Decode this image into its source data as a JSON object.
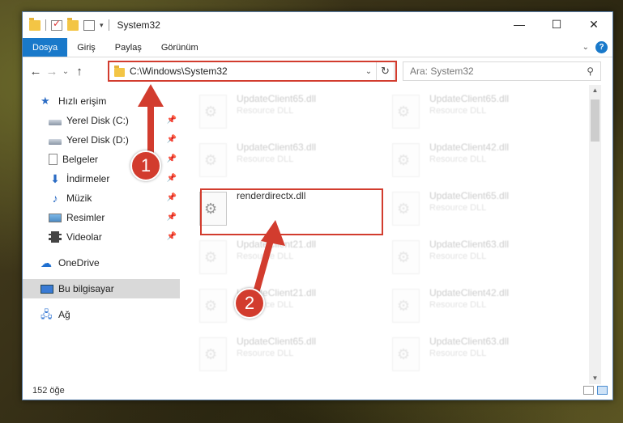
{
  "window": {
    "title": "System32",
    "controls": {
      "minimize": "—",
      "maximize": "☐",
      "close": "✕"
    }
  },
  "ribbon": {
    "tabs": [
      {
        "label": "Dosya",
        "active": true
      },
      {
        "label": "Giriş"
      },
      {
        "label": "Paylaş"
      },
      {
        "label": "Görünüm"
      }
    ]
  },
  "nav": {
    "back": "←",
    "forward": "→",
    "recent": "⌄",
    "up": "↑",
    "address": "C:\\Windows\\System32",
    "search_placeholder": "Ara: System32"
  },
  "sidebar": {
    "items": [
      {
        "label": "Hızlı erişim",
        "icon": "star-icon"
      },
      {
        "label": "Yerel Disk (C:)",
        "icon": "disk-icon",
        "pinned": true
      },
      {
        "label": "Yerel Disk (D:)",
        "icon": "disk-icon",
        "pinned": true
      },
      {
        "label": "Belgeler",
        "icon": "document-icon",
        "pinned": true
      },
      {
        "label": "İndirmeler",
        "icon": "download-icon",
        "pinned": true
      },
      {
        "label": "Müzik",
        "icon": "music-icon",
        "pinned": true
      },
      {
        "label": "Resimler",
        "icon": "picture-icon",
        "pinned": true
      },
      {
        "label": "Videolar",
        "icon": "video-icon",
        "pinned": true
      },
      {
        "label": "OneDrive",
        "icon": "cloud-icon"
      },
      {
        "label": "Bu bilgisayar",
        "icon": "computer-icon",
        "selected": true
      },
      {
        "label": "Ağ",
        "icon": "network-icon"
      }
    ]
  },
  "files": [
    {
      "name": "UpdateClient65.dll",
      "type": "Resource DLL",
      "faded": true
    },
    {
      "name": "UpdateClient65.dll",
      "type": "Resource DLL",
      "faded": true
    },
    {
      "name": "UpdateClient63.dll",
      "type": "Resource DLL",
      "faded": true
    },
    {
      "name": "UpdateClient42.dll",
      "type": "Resource DLL",
      "faded": true
    },
    {
      "name": "renderdirectx.dll",
      "type": "",
      "faded": false
    },
    {
      "name": "UpdateClient65.dll",
      "type": "Resource DLL",
      "faded": true
    },
    {
      "name": "UpdateClient21.dll",
      "type": "Resource DLL",
      "faded": true
    },
    {
      "name": "UpdateClient63.dll",
      "type": "Resource DLL",
      "faded": true
    },
    {
      "name": "UpdateClient21.dll",
      "type": "Resource DLL",
      "faded": true
    },
    {
      "name": "UpdateClient42.dll",
      "type": "Resource DLL",
      "faded": true
    },
    {
      "name": "UpdateClient65.dll",
      "type": "Resource DLL",
      "faded": true
    },
    {
      "name": "UpdateClient63.dll",
      "type": "Resource DLL",
      "faded": true
    }
  ],
  "status": {
    "count": "152 öğe"
  },
  "annotations": {
    "step1": "1",
    "step2": "2",
    "color": "#d23c2e"
  }
}
